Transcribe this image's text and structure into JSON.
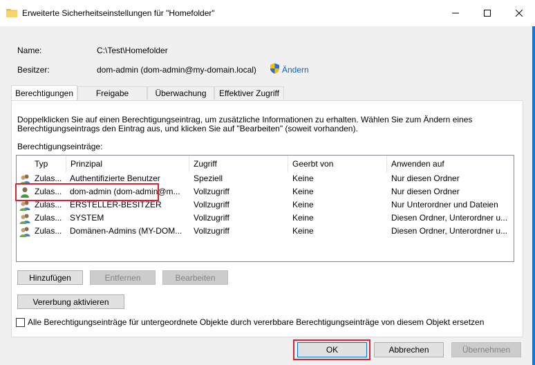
{
  "window": {
    "title": "Erweiterte Sicherheitseinstellungen für \"Homefolder\""
  },
  "info": {
    "name_label": "Name:",
    "name_value": "C:\\Test\\Homefolder",
    "owner_label": "Besitzer:",
    "owner_value": "dom-admin (dom-admin@my-domain.local)",
    "change_link": "Ändern"
  },
  "tabs": [
    {
      "label": "Berechtigungen",
      "active": true
    },
    {
      "label": "Freigabe",
      "active": false
    },
    {
      "label": "Überwachung",
      "active": false
    },
    {
      "label": "Effektiver Zugriff",
      "active": false
    }
  ],
  "panel": {
    "instructions_line1": "Doppelklicken Sie auf einen Berechtigungseintrag, um zusätzliche Informationen zu erhalten. Wählen Sie zum Ändern eines",
    "instructions_line2": "Berechtigungseintrags den Eintrag aus, und klicken Sie auf \"Bearbeiten\" (soweit vorhanden).",
    "entries_label": "Berechtigungseinträge:",
    "columns": [
      "Typ",
      "Prinzipal",
      "Zugriff",
      "Geerbt von",
      "Anwenden auf"
    ],
    "rows": [
      {
        "type": "Zulas...",
        "principal": "Authentifizierte Benutzer",
        "access": "Speziell",
        "inherited": "Keine",
        "apply": "Nur diesen Ordner"
      },
      {
        "type": "Zulas...",
        "principal": "dom-admin (dom-admin@m...",
        "access": "Vollzugriff",
        "inherited": "Keine",
        "apply": "Nur diesen Ordner"
      },
      {
        "type": "Zulas...",
        "principal": "ERSTELLER-BESITZER",
        "access": "Vollzugriff",
        "inherited": "Keine",
        "apply": "Nur Unterordner und Dateien"
      },
      {
        "type": "Zulas...",
        "principal": "SYSTEM",
        "access": "Vollzugriff",
        "inherited": "Keine",
        "apply": "Diesen Ordner, Unterordner u..."
      },
      {
        "type": "Zulas...",
        "principal": "Domänen-Admins (MY-DOM...",
        "access": "Vollzugriff",
        "inherited": "Keine",
        "apply": "Diesen Ordner, Unterordner u..."
      }
    ],
    "add_button": "Hinzufügen",
    "remove_button": "Entfernen",
    "edit_button": "Bearbeiten",
    "inherit_button": "Vererbung aktivieren",
    "replace_checkbox_label": "Alle Berechtigungseinträge für untergeordnete Objekte durch vererbbare Berechtigungseinträge von diesem Objekt ersetzen"
  },
  "footer": {
    "ok_button": "OK",
    "cancel_button": "Abbrechen",
    "apply_button": "Übernehmen"
  },
  "colors": {
    "accent": "#0078d7",
    "highlight": "#d9232e",
    "link": "#0066cc"
  }
}
